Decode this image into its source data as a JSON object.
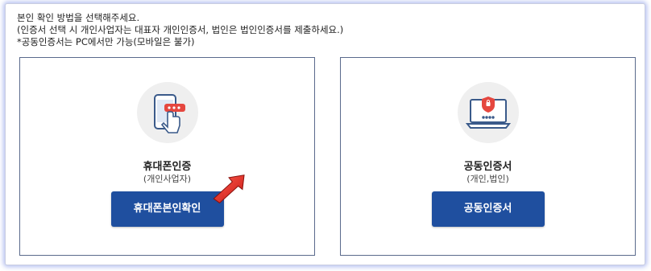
{
  "intro": {
    "line1": "본인 확인 방법을 선택해주세요.",
    "line2": "(인증서 선택 시 개인사업자는 대표자 개인인증서, 법인은 법인인증서를 제출하세요.)",
    "line3": "*공동인증서는 PC에서만 가능(모바일은 불가)"
  },
  "cards": {
    "phone": {
      "title": "휴대폰인증",
      "subtitle": "(개인사업자)",
      "button": "휴대폰본인확인",
      "icon": "phone-tap-icon"
    },
    "cert": {
      "title": "공동인증서",
      "subtitle": "(개인,법인)",
      "button": "공동인증서",
      "icon": "laptop-shield-icon"
    }
  },
  "colors": {
    "button": "#1f4f9f",
    "card_border": "#5a6a8c",
    "arrow": "#e8261f",
    "outer_glow": "#7b8ee6"
  }
}
